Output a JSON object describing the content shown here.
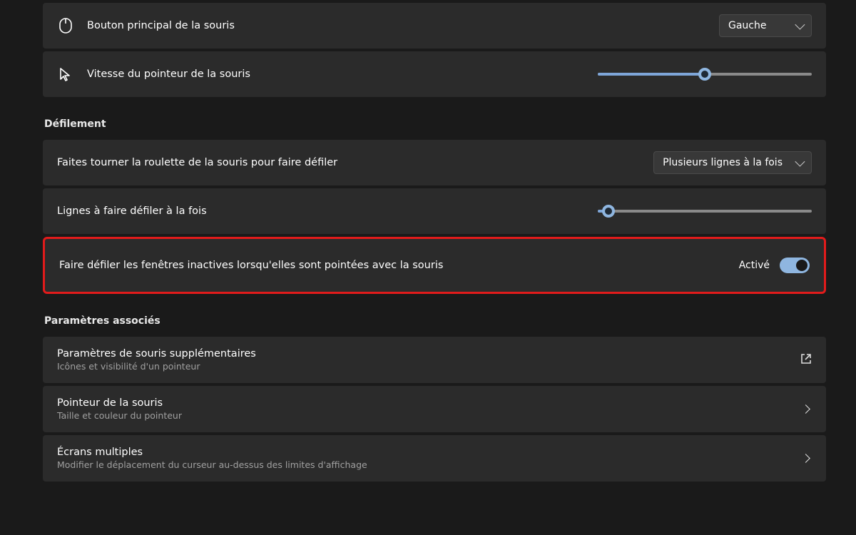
{
  "primary_button": {
    "label": "Bouton principal de la souris",
    "value": "Gauche"
  },
  "pointer_speed": {
    "label": "Vitesse du pointeur de la souris",
    "percent": 50
  },
  "scrolling": {
    "section_title": "Défilement",
    "roll_wheel": {
      "label": "Faites tourner la roulette de la souris pour faire défiler",
      "value": "Plusieurs lignes à la fois"
    },
    "lines_at_time": {
      "label": "Lignes à faire défiler à la fois",
      "percent": 5
    },
    "inactive_scroll": {
      "label": "Faire défiler les fenêtres inactives lorsqu'elles sont pointées avec la souris",
      "state_label": "Activé"
    }
  },
  "related": {
    "section_title": "Paramètres associés",
    "additional": {
      "title": "Paramètres de souris supplémentaires",
      "subtitle": "Icônes et visibilité d'un pointeur"
    },
    "mouse_pointer": {
      "title": "Pointeur de la souris",
      "subtitle": "Taille et couleur du pointeur"
    },
    "multi_display": {
      "title": "Écrans multiples",
      "subtitle": "Modifier le déplacement du curseur au-dessus des limites d'affichage"
    }
  }
}
